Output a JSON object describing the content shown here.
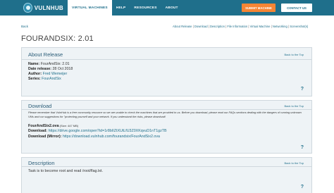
{
  "header": {
    "logo_text": "VULNHUB",
    "nav": [
      "VIRTUAL MACHINES",
      "HELP",
      "RESOURCES",
      "ABOUT"
    ],
    "submit_label": "SUBMIT MACHINE",
    "contact_label": "CONTACT US",
    "colors": {
      "bar": "#1f6f8b",
      "submit": "#f58534"
    }
  },
  "top": {
    "back": "Back",
    "section_links": [
      "About Release",
      "Download",
      "Description",
      "File Information",
      "Virtual Machine",
      "Networking",
      "Screenshot(s)"
    ],
    "separator": " | "
  },
  "title": "FOURANDSIX: 2.01",
  "about": {
    "title": "About Release",
    "back_to_top": "Back to the Top",
    "name_label": "Name:",
    "name_value": "FourAndSix: 2.01",
    "date_label": "Date release:",
    "date_value": "28 Oct 2018",
    "author_label": "Author:",
    "author_value": "Fred Wemeijer",
    "series_label": "Series:",
    "series_value": "FourAndSix",
    "help": "?"
  },
  "download": {
    "title": "Download",
    "back_to_top": "Back to the Top",
    "note": "Please remember that VulnHub is a free community resource so we are unable to check the machines that are provided to us. Before you download, please read our FAQs sections dealing with the dangers of running unknown VMs and our suggestions for \"protecting yourself and your network. If you understand the risks, please download!",
    "file_name": "FourAndSix2.ova",
    "file_size": " (Size: 447 MB)",
    "download_label": "Download:",
    "download_url": "https://drive.google.com/open?id=1r8bIIZtXUtLfU3Z0XKqvuD1nT1gzTB",
    "mirror_label": "Download (Mirror):",
    "mirror_url": "https://download.vulnhub.com/fourandsix/FourAndSix2.ova",
    "help": "?"
  },
  "description": {
    "title": "Description",
    "back_to_top": "Back to the Top",
    "text": "Task is to become root and read /root/flag.txt.",
    "help": "?"
  }
}
